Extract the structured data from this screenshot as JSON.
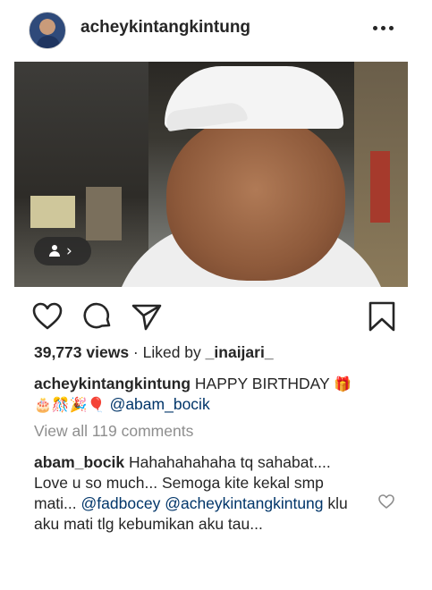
{
  "post": {
    "username": "acheykintangkintung",
    "views_count": "39,773 views",
    "separator": " · Liked by ",
    "liked_by_user": "_inaijari_",
    "caption": {
      "author": "acheykintangkintung",
      "text": "HAPPY BIRTHDAY",
      "emoji_gift": "🎁",
      "emoji_row": "🎂🎊🎉🎈",
      "mention": "@abam_bocik"
    },
    "view_all_comments": "View all 119 comments",
    "comment": {
      "author": "abam_bocik",
      "text_part1": "Hahahahahaha tq sahabat.... Love u so much... Semoga kite kekal smp mati...",
      "mention1": "@fadbocey",
      "mention2": "@acheykintangkintung",
      "text_part2": "klu aku mati tlg kebumikan aku tau..."
    }
  },
  "icons": {
    "more": "more-options-icon",
    "like": "heart-icon",
    "comment": "comment-bubble-icon",
    "share": "paper-plane-icon",
    "save": "bookmark-icon",
    "tag": "tagged-person-icon",
    "comment_like": "heart-outline-icon"
  },
  "colors": {
    "text": "#262626",
    "muted": "#8e8e8e",
    "mention": "#003569"
  }
}
